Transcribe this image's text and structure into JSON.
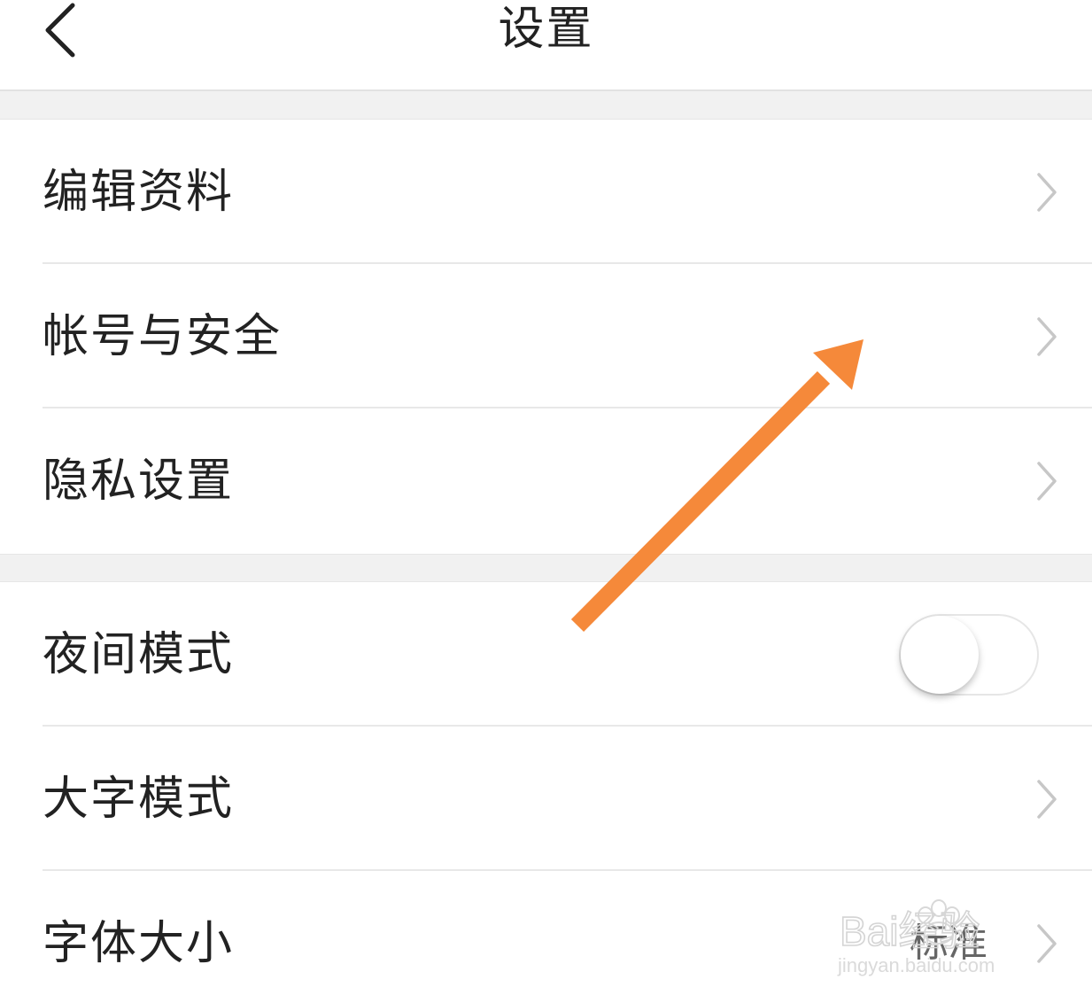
{
  "header": {
    "title": "设置",
    "back_icon": "chevron-left-icon"
  },
  "section1": {
    "items": [
      {
        "label": "编辑资料",
        "trailing": "chevron-right-icon"
      },
      {
        "label": "帐号与安全",
        "trailing": "chevron-right-icon"
      },
      {
        "label": "隐私设置",
        "trailing": "chevron-right-icon"
      }
    ]
  },
  "section2": {
    "items": [
      {
        "label": "夜间模式",
        "trailing": "toggle-switch",
        "toggle_on": false
      },
      {
        "label": "大字模式",
        "trailing": "chevron-right-icon"
      },
      {
        "label": "字体大小",
        "value": "标准",
        "trailing": "chevron-right-icon"
      }
    ]
  },
  "annotation": {
    "icon": "arrow-icon",
    "color": "#F5893A"
  },
  "watermark": {
    "text_main": "Bai经验",
    "text_sub": "jingyan.baidu.com"
  },
  "colors": {
    "background": "#FFFFFF",
    "section_gap": "#F1F1F1",
    "divider": "#E8E8E8",
    "text": "#222222",
    "chevron": "#C7C7C7"
  }
}
